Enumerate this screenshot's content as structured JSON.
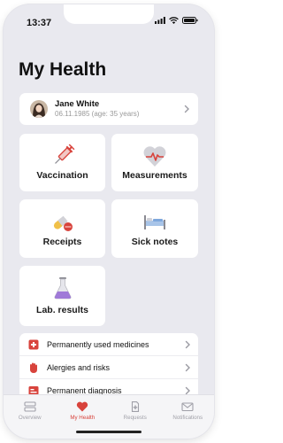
{
  "status_bar": {
    "time": "13:37",
    "icons": [
      "signal-icon",
      "wifi-icon",
      "battery-icon"
    ]
  },
  "page": {
    "title": "My Health"
  },
  "profile": {
    "name": "Jane White",
    "details": "06.11.1985 (age: 35 years)"
  },
  "tiles": [
    {
      "label": "Vaccination",
      "icon": "syringe-icon"
    },
    {
      "label": "Measurements",
      "icon": "heart-pulse-icon"
    },
    {
      "label": "Receipts",
      "icon": "pills-icon"
    },
    {
      "label": "Sick notes",
      "icon": "bed-icon"
    },
    {
      "label": "Lab. results",
      "icon": "flask-icon"
    }
  ],
  "list": [
    {
      "label": "Permanently used medicines",
      "icon": "medicine-icon"
    },
    {
      "label": "Alergies and risks",
      "icon": "hand-icon"
    },
    {
      "label": "Permanent diagnosis",
      "icon": "diagnosis-icon"
    }
  ],
  "tabbar": [
    {
      "label": "Overview",
      "icon": "overview-icon",
      "active": false
    },
    {
      "label": "My Health",
      "icon": "heart-icon",
      "active": true
    },
    {
      "label": "Requests",
      "icon": "document-icon",
      "active": false
    },
    {
      "label": "Notifications",
      "icon": "mail-icon",
      "active": false
    }
  ],
  "colors": {
    "accent": "#d8433c",
    "background": "#e9e9ef",
    "card": "#ffffff",
    "muted": "#a0a0a8"
  }
}
